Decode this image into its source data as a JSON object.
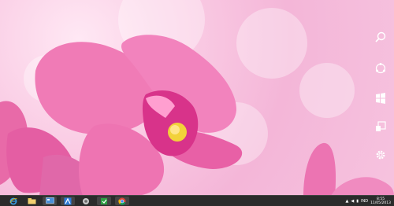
{
  "wallpaper": {
    "subject": "pink orchid",
    "accent": "#e85aa8",
    "background": "#f4b6d8"
  },
  "charms": [
    {
      "name": "search",
      "icon": "search-icon"
    },
    {
      "name": "share",
      "icon": "share-icon"
    },
    {
      "name": "start",
      "icon": "windows-logo-icon"
    },
    {
      "name": "devices",
      "icon": "devices-icon"
    },
    {
      "name": "settings",
      "icon": "gear-icon"
    }
  ],
  "taskbar": {
    "apps": [
      {
        "name": "internet-explorer",
        "icon": "ie-icon"
      },
      {
        "name": "file-explorer",
        "icon": "folder-icon"
      },
      {
        "name": "control-panel",
        "icon": "control-panel-icon"
      },
      {
        "name": "app-blue",
        "icon": "blue-app-icon"
      },
      {
        "name": "network-app",
        "icon": "network-icon"
      },
      {
        "name": "green-app",
        "icon": "green-app-icon"
      },
      {
        "name": "chrome",
        "icon": "chrome-icon"
      }
    ],
    "tray": {
      "language": "IND",
      "time": "8:55",
      "date": "11/05/2013"
    }
  }
}
